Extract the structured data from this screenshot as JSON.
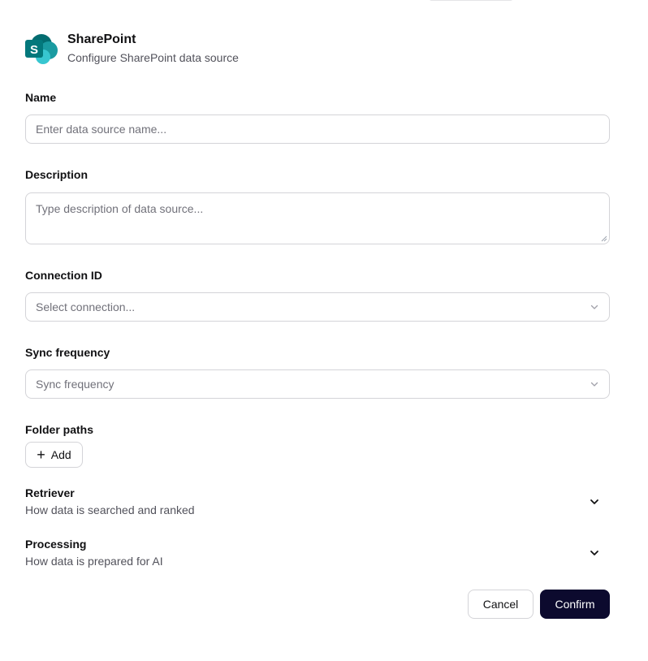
{
  "header": {
    "title": "SharePoint",
    "subtitle": "Configure SharePoint data source",
    "logo_letter": "S"
  },
  "form": {
    "name": {
      "label": "Name",
      "placeholder": "Enter data source name..."
    },
    "description": {
      "label": "Description",
      "placeholder": "Type description of data source..."
    },
    "connection": {
      "label": "Connection ID",
      "placeholder": "Select connection..."
    },
    "sync": {
      "label": "Sync frequency",
      "placeholder": "Sync frequency"
    },
    "folders": {
      "label": "Folder paths",
      "add_label": "Add"
    }
  },
  "sections": {
    "retriever": {
      "title": "Retriever",
      "desc": "How data is searched and ranked"
    },
    "processing": {
      "title": "Processing",
      "desc": "How data is prepared for AI"
    }
  },
  "actions": {
    "cancel": "Cancel",
    "confirm": "Confirm"
  },
  "colors": {
    "primary": "#0c0a2e",
    "border": "#d4d4d8",
    "muted": "#52525b",
    "sharepoint_teal": "#1a9ba1"
  }
}
